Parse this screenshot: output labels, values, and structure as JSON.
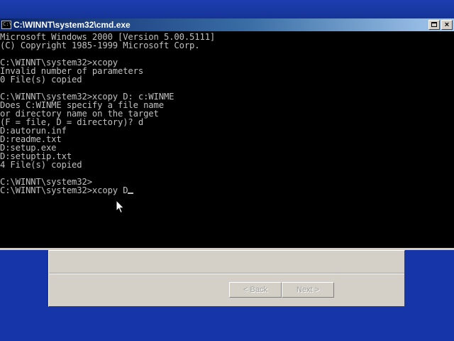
{
  "console": {
    "title": "C:\\WINNT\\system32\\cmd.exe",
    "icon": "console-icon",
    "icon_text": "C:\\",
    "lines": [
      "Microsoft Windows 2000 [Version 5.00.5111]",
      "(C) Copyright 1985-1999 Microsoft Corp.",
      "",
      "C:\\WINNT\\system32>xcopy",
      "Invalid number of parameters",
      "0 File(s) copied",
      "",
      "C:\\WINNT\\system32>xcopy D: c:WINME",
      "Does C:WINME specify a file name",
      "or directory name on the target",
      "(F = file, D = directory)? d",
      "D:autorun.inf",
      "D:readme.txt",
      "D:setup.exe",
      "D:setuptip.txt",
      "4 File(s) copied",
      "",
      "C:\\WINNT\\system32>",
      "C:\\WINNT\\system32>xcopy D"
    ]
  },
  "wizard": {
    "back_label": "< Back",
    "next_label": "Next >"
  },
  "colors": {
    "desktop": "#1a3da8",
    "titlebar_start": "#0a246a",
    "titlebar_end": "#a6caf0",
    "console_text": "#c0c0c0",
    "console_bg": "#000000"
  }
}
